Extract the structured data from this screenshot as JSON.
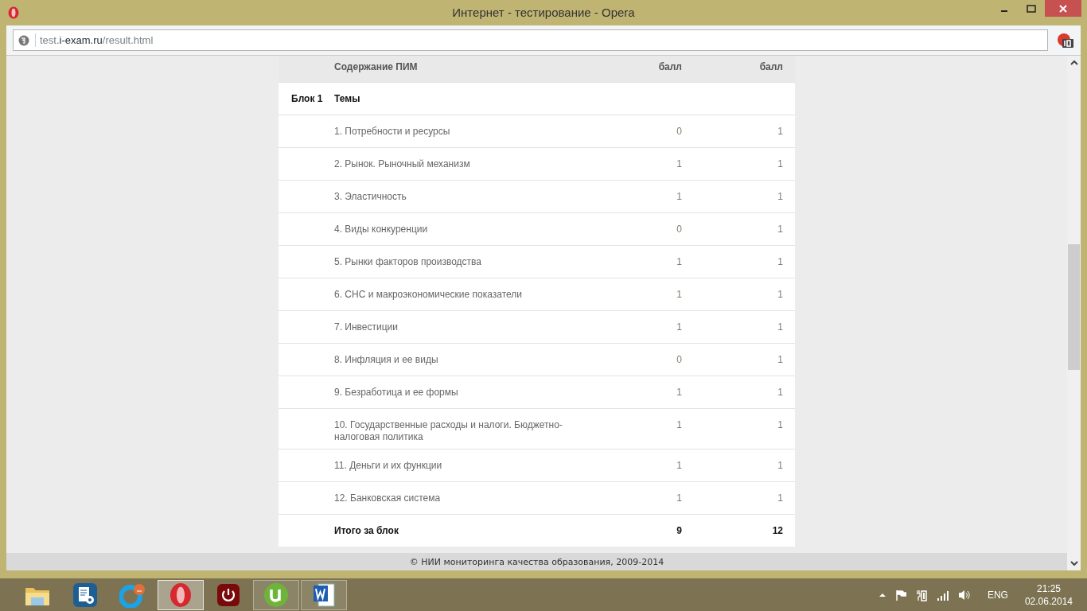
{
  "window": {
    "title": "Интернет - тестирование - Opera"
  },
  "address_bar": {
    "subdomain": "test.",
    "domain": "i-exam.ru",
    "path": "/result.html"
  },
  "table": {
    "columns": [
      {
        "label": "Содержание ПИМ"
      },
      {
        "label": "балл"
      },
      {
        "label": "балл"
      }
    ],
    "rows": [
      {
        "kind": "block",
        "column_1": "Блок 1",
        "column_2": "Темы"
      },
      {
        "kind": "topic",
        "column_2": "1. Потребности и ресурсы",
        "column_3": "0",
        "column_4": "1"
      },
      {
        "kind": "topic",
        "column_2": "2. Рынок. Рыночный механизм",
        "column_3": "1",
        "column_4": "1"
      },
      {
        "kind": "topic",
        "column_2": "3. Эластичность",
        "column_3": "1",
        "column_4": "1"
      },
      {
        "kind": "topic",
        "column_2": "4. Виды конкуренции",
        "column_3": "0",
        "column_4": "1"
      },
      {
        "kind": "topic",
        "column_2": "5. Рынки факторов производства",
        "column_3": "1",
        "column_4": "1"
      },
      {
        "kind": "topic",
        "column_2": "6. СНС и макроэкономические показатели",
        "column_3": "1",
        "column_4": "1"
      },
      {
        "kind": "topic",
        "column_2": "7. Инвестиции",
        "column_3": "1",
        "column_4": "1"
      },
      {
        "kind": "topic",
        "column_2": "8. Инфляция и ее виды",
        "column_3": "0",
        "column_4": "1"
      },
      {
        "kind": "topic",
        "column_2": "9. Безработица и ее формы",
        "column_3": "1",
        "column_4": "1"
      },
      {
        "kind": "topic",
        "column_2": "10. Государственные расходы и налоги. Бюджетно-налоговая политика",
        "column_3": "1",
        "column_4": "1"
      },
      {
        "kind": "topic",
        "column_2": "11. Деньги и их функции",
        "column_3": "1",
        "column_4": "1"
      },
      {
        "kind": "topic",
        "column_2": "12. Банковская система",
        "column_3": "1",
        "column_4": "1"
      },
      {
        "kind": "total",
        "column_2": "Итого за блок",
        "column_3": "9",
        "column_4": "12"
      }
    ]
  },
  "footer": "© НИИ мониторинга качества образования, 2009-2014",
  "taskbar": {
    "apps": [
      {
        "kind": "folder",
        "running": false,
        "selected": false
      },
      {
        "kind": "settings-doc",
        "running": false,
        "selected": false
      },
      {
        "kind": "chat",
        "running": false,
        "selected": false
      },
      {
        "kind": "opera",
        "running": true,
        "selected": true
      },
      {
        "kind": "power",
        "running": false,
        "selected": false
      },
      {
        "kind": "torrent",
        "running": true,
        "selected": false
      },
      {
        "kind": "word",
        "running": true,
        "selected": false
      }
    ]
  },
  "tray": {
    "language": "ENG",
    "time": "21:25",
    "date": "02.06.2014"
  }
}
